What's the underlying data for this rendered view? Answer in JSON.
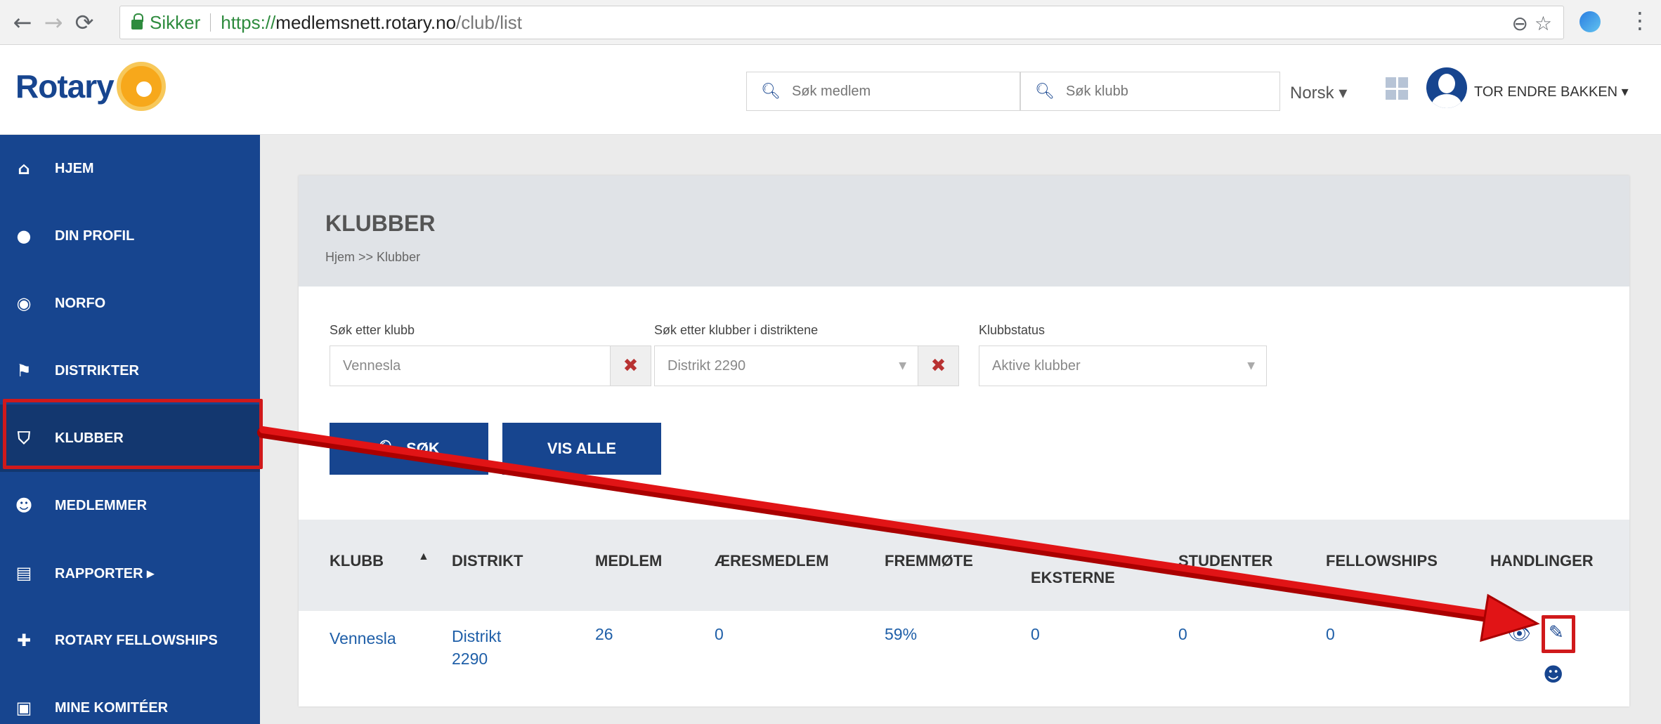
{
  "browser": {
    "secure_label": "Sikker",
    "url_scheme": "https://",
    "url_host": "medlemsnett.rotary.no",
    "url_path": "/club/list"
  },
  "header": {
    "logo_text": "Rotary",
    "search_member_placeholder": "Søk medlem",
    "search_club_placeholder": "Søk klubb",
    "language": "Norsk ▾",
    "username": "TOR ENDRE BAKKEN ▾"
  },
  "sidebar": {
    "items": [
      {
        "label": "HJEM",
        "icon": "home-icon"
      },
      {
        "label": "DIN PROFIL",
        "icon": "user-icon"
      },
      {
        "label": "NORFO",
        "icon": "globe-icon"
      },
      {
        "label": "DISTRIKTER",
        "icon": "flag-icon"
      },
      {
        "label": "KLUBBER",
        "icon": "shield-icon"
      },
      {
        "label": "MEDLEMMER",
        "icon": "users-icon"
      },
      {
        "label": "RAPPORTER ▸",
        "icon": "document-icon"
      },
      {
        "label": "ROTARY FELLOWSHIPS",
        "icon": "user-plus-icon"
      },
      {
        "label": "MINE KOMITÉER",
        "icon": "briefcase-icon"
      }
    ],
    "active_index": 4
  },
  "page": {
    "title": "KLUBBER",
    "breadcrumb": "Hjem >> Klubber"
  },
  "filters": {
    "club_label": "Søk etter klubb",
    "club_value": "Vennesla",
    "district_label": "Søk etter klubber i distriktene",
    "district_value": "Distrikt 2290",
    "status_label": "Klubbstatus",
    "status_value": "Aktive klubber"
  },
  "buttons": {
    "search": "SØK",
    "show_all": "VIS ALLE"
  },
  "table": {
    "columns": [
      "KLUBB",
      "DISTRIKT",
      "MEDLEM",
      "ÆRESMEDLEM",
      "FREMMØTE",
      "EKSTERNE",
      "STUDENTER",
      "FELLOWSHIPS",
      "HANDLINGER"
    ],
    "rows": [
      {
        "klubb": "Vennesla",
        "distrikt": "Distrikt 2290",
        "medlem": "26",
        "aeresmedlem": "0",
        "fremmote": "59%",
        "eksterne": "0",
        "studenter": "0",
        "fellowships": "0"
      }
    ]
  },
  "colors": {
    "brand_blue": "#17458f",
    "highlight_red": "#d0191b",
    "rotary_gold": "#f7a81b"
  }
}
